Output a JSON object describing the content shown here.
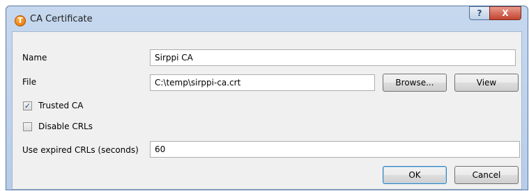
{
  "window": {
    "title": "CA Certificate",
    "app_icon_glyph": "T",
    "help_glyph": "?",
    "close_glyph": "X"
  },
  "form": {
    "name_label": "Name",
    "name_value": "Sirppi CA",
    "file_label": "File",
    "file_value": "C:\\temp\\sirppi-ca.crt",
    "browse_label": "Browse...",
    "view_label": "View",
    "trusted_label": "Trusted CA",
    "trusted_checked": true,
    "disable_crls_label": "Disable CRLs",
    "disable_crls_checked": false,
    "expired_label": "Use expired CRLs (seconds)",
    "expired_value": "60"
  },
  "buttons": {
    "ok": "OK",
    "cancel": "Cancel"
  },
  "colors": {
    "title_bar": "#c6d8ee",
    "close_button": "#c24430",
    "dialog_bg": "#f0f0f0"
  }
}
